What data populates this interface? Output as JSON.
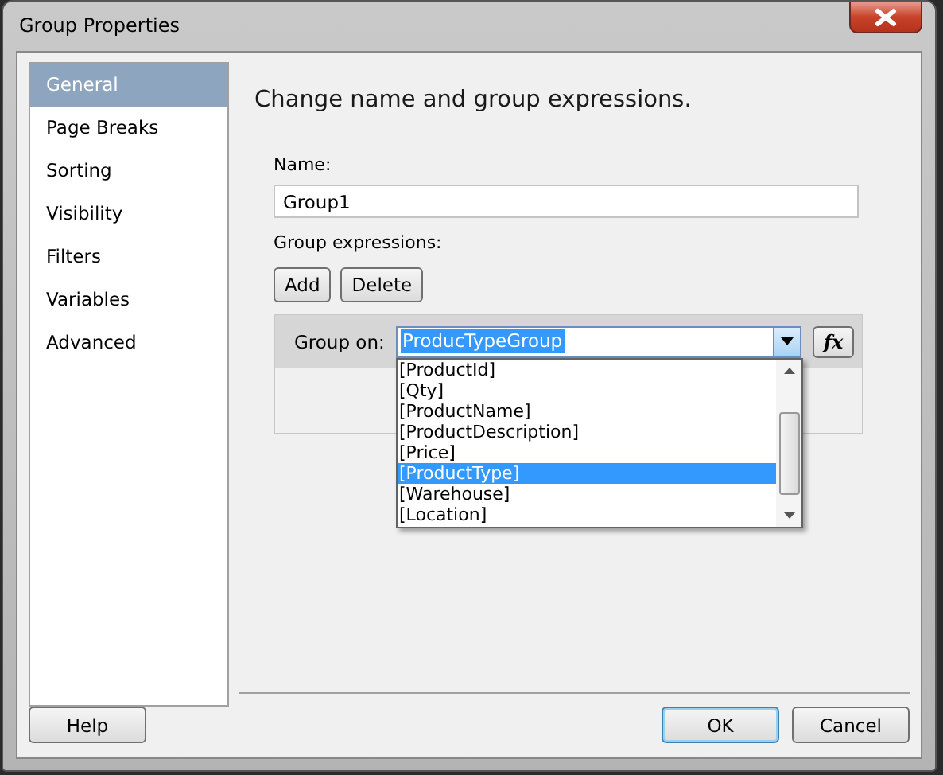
{
  "window": {
    "title": "Group Properties"
  },
  "sidebar": {
    "items": [
      {
        "label": "General",
        "selected": true
      },
      {
        "label": "Page Breaks",
        "selected": false
      },
      {
        "label": "Sorting",
        "selected": false
      },
      {
        "label": "Visibility",
        "selected": false
      },
      {
        "label": "Filters",
        "selected": false
      },
      {
        "label": "Variables",
        "selected": false
      },
      {
        "label": "Advanced",
        "selected": false
      }
    ]
  },
  "heading": "Change name and group expressions.",
  "name_field": {
    "label": "Name:",
    "value": "Group1"
  },
  "group_expressions": {
    "label": "Group expressions:",
    "buttons": [
      "Add",
      "Delete"
    ],
    "group_on": {
      "label": "Group on:",
      "value": "ProducTypeGroup",
      "expression_button": "fx",
      "dropdown_items": [
        {
          "label": "[ProductId]",
          "selected": false
        },
        {
          "label": "[Qty]",
          "selected": false
        },
        {
          "label": "[ProductName]",
          "selected": false
        },
        {
          "label": "[ProductDescription]",
          "selected": false
        },
        {
          "label": "[Price]",
          "selected": false
        },
        {
          "label": "[ProductType]",
          "selected": true
        },
        {
          "label": "[Warehouse]",
          "selected": false
        },
        {
          "label": "[Location]",
          "selected": false
        }
      ]
    }
  },
  "footer_buttons": [
    {
      "label": "Help",
      "default": false
    },
    {
      "label": "OK",
      "default": true
    },
    {
      "label": "Cancel",
      "default": false
    }
  ]
}
